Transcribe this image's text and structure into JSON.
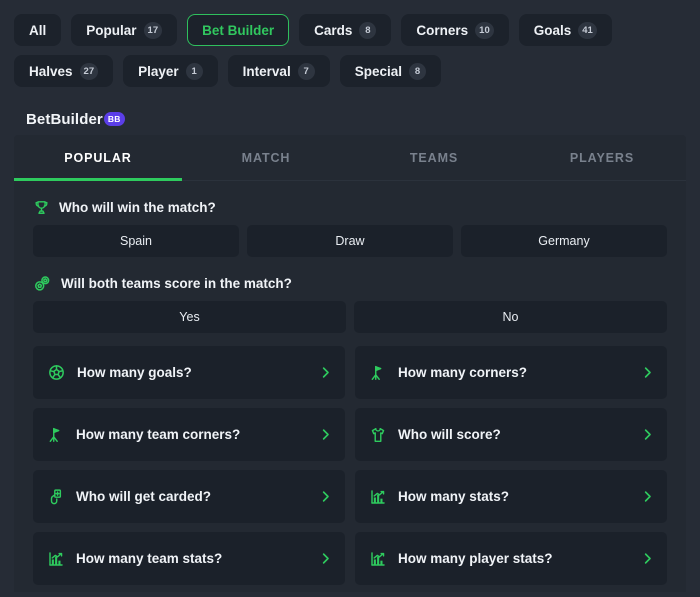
{
  "colors": {
    "page_background": "#262c36",
    "panel_background": "#232932",
    "tile_background": "#1b212a",
    "accent_green": "#2ecb5e",
    "badge_purple": "#5b3ee8"
  },
  "filter_chips": [
    {
      "label": "All",
      "count": null,
      "active": false
    },
    {
      "label": "Popular",
      "count": "17",
      "active": false
    },
    {
      "label": "Bet Builder",
      "count": null,
      "active": true
    },
    {
      "label": "Cards",
      "count": "8",
      "active": false
    },
    {
      "label": "Corners",
      "count": "10",
      "active": false
    },
    {
      "label": "Goals",
      "count": "41",
      "active": false
    },
    {
      "label": "Halves",
      "count": "27",
      "active": false
    },
    {
      "label": "Player",
      "count": "1",
      "active": false
    },
    {
      "label": "Interval",
      "count": "7",
      "active": false
    },
    {
      "label": "Special",
      "count": "8",
      "active": false
    }
  ],
  "provider": {
    "name": "BetBuilder",
    "badge": "BB"
  },
  "tabs": [
    {
      "label": "POPULAR",
      "active": true
    },
    {
      "label": "MATCH",
      "active": false
    },
    {
      "label": "TEAMS",
      "active": false
    },
    {
      "label": "PLAYERS",
      "active": false
    }
  ],
  "markets": [
    {
      "icon": "trophy-icon",
      "title": "Who will win the match?",
      "outcomes": [
        "Spain",
        "Draw",
        "Germany"
      ]
    },
    {
      "icon": "two-footballs-icon",
      "title": "Will both teams score in the match?",
      "outcomes": [
        "Yes",
        "No"
      ]
    }
  ],
  "expandable_markets": [
    {
      "icon": "football-icon",
      "label": "How many goals?",
      "chevron": "chevron-right-icon"
    },
    {
      "icon": "corner-flag-icon",
      "label": "How many corners?",
      "chevron": "chevron-right-icon"
    },
    {
      "icon": "corner-flag-icon",
      "label": "How many team corners?",
      "chevron": "chevron-right-icon"
    },
    {
      "icon": "jersey-icon",
      "label": "Who will score?",
      "chevron": "chevron-right-icon"
    },
    {
      "icon": "card-hand-icon",
      "label": "Who will get carded?",
      "chevron": "chevron-right-icon"
    },
    {
      "icon": "bar-chart-icon",
      "label": "How many stats?",
      "chevron": "chevron-right-icon"
    },
    {
      "icon": "bar-chart-icon",
      "label": "How many team stats?",
      "chevron": "chevron-right-icon"
    },
    {
      "icon": "bar-chart-icon",
      "label": "How many player stats?",
      "chevron": "chevron-right-icon"
    }
  ]
}
